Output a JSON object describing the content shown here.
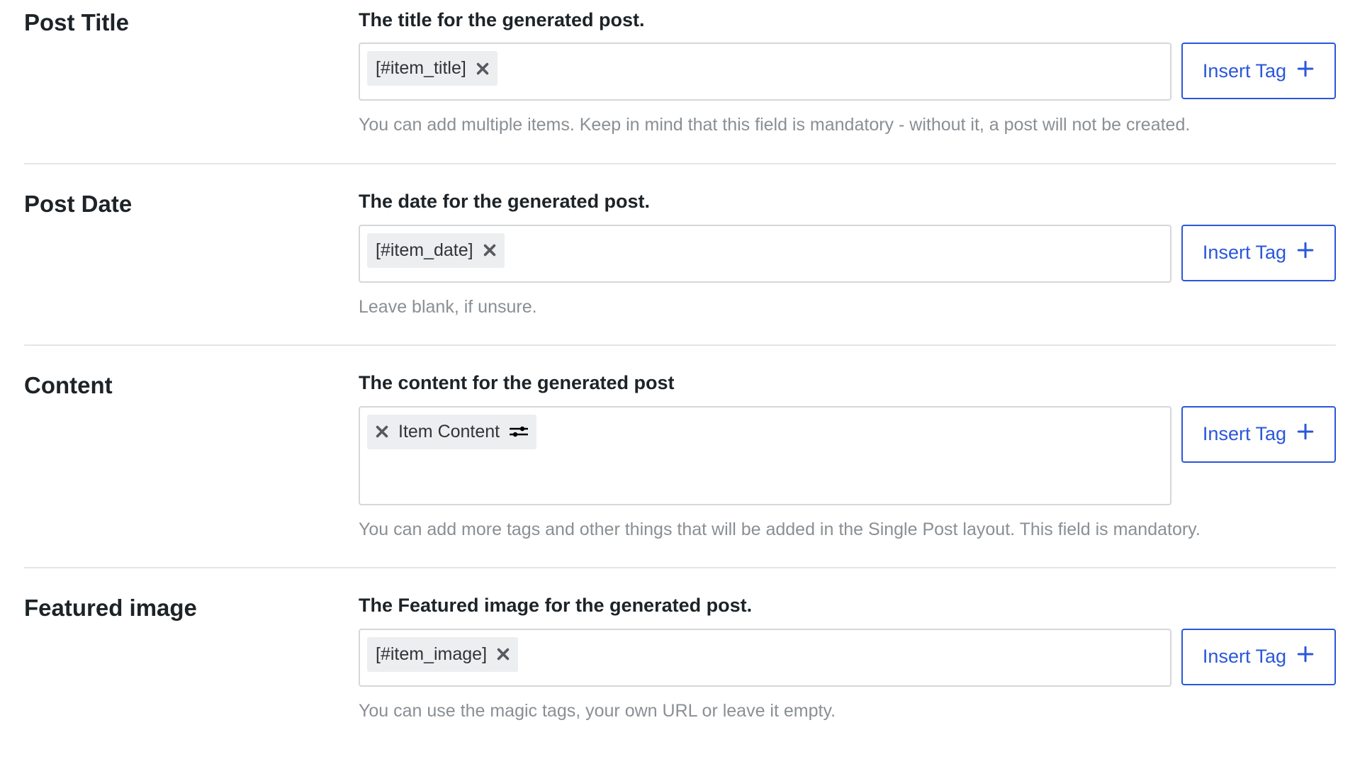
{
  "sections": {
    "title": {
      "label": "Post Title",
      "description": "The title for the generated post.",
      "chip": "[#item_title]",
      "help": "You can add multiple items. Keep in mind that this field is mandatory - without it, a post will not be created."
    },
    "date": {
      "label": "Post Date",
      "description": "The date for the generated post.",
      "chip": "[#item_date]",
      "help": "Leave blank, if unsure."
    },
    "content": {
      "label": "Content",
      "description": "The content for the generated post",
      "chip": "Item Content",
      "help": "You can add more tags and other things that will be added in the Single Post layout. This field is mandatory."
    },
    "image": {
      "label": "Featured image",
      "description": "The Featured image for the generated post.",
      "chip": "[#item_image]",
      "help": "You can use the magic tags, your own URL or leave it empty."
    }
  },
  "ui": {
    "insert_tag": "Insert Tag"
  }
}
